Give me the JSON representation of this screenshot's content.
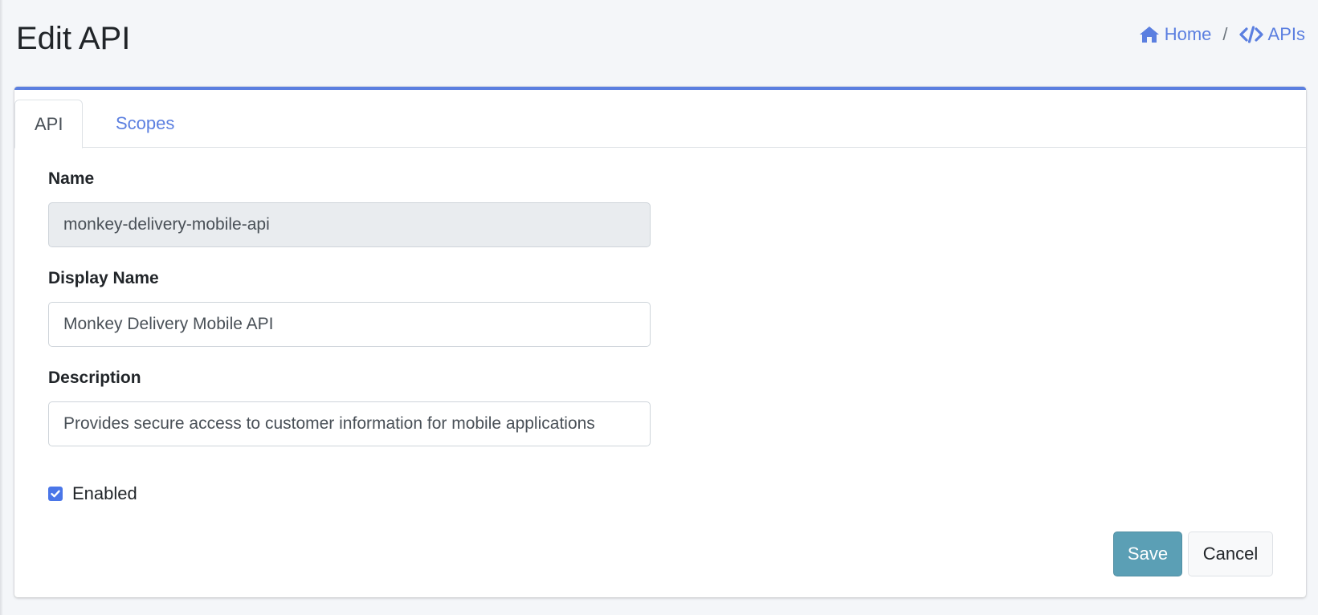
{
  "page": {
    "title": "Edit API"
  },
  "breadcrumb": {
    "home_label": "Home",
    "separator": "/",
    "apis_label": "APIs"
  },
  "tabs": [
    {
      "label": "API",
      "active": true
    },
    {
      "label": "Scopes",
      "active": false
    }
  ],
  "form": {
    "name": {
      "label": "Name",
      "value": "monkey-delivery-mobile-api"
    },
    "display_name": {
      "label": "Display Name",
      "value": "Monkey Delivery Mobile API"
    },
    "description": {
      "label": "Description",
      "value": "Provides secure access to customer information for mobile applications"
    },
    "enabled": {
      "label": "Enabled",
      "checked": true
    }
  },
  "actions": {
    "save_label": "Save",
    "cancel_label": "Cancel"
  },
  "colors": {
    "accent": "#5b7fe0",
    "save_button": "#5b9fb5",
    "background": "#f4f6f9"
  },
  "icons": {
    "home": "home-icon",
    "apis": "code-icon",
    "checkbox": "checkmark-icon"
  }
}
